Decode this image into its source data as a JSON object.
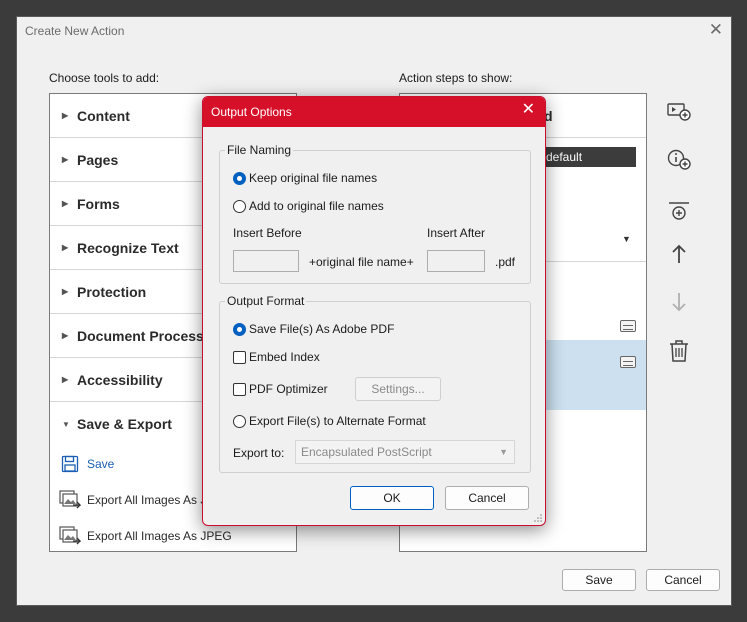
{
  "outer_dialog": {
    "title": "Create New Action",
    "tools_label": "Choose tools to add:",
    "steps_label": "Action steps to show:",
    "save_button": "Save",
    "cancel_button": "Cancel"
  },
  "tools": {
    "categories": [
      {
        "label": "Content",
        "expanded": false
      },
      {
        "label": "Pages",
        "expanded": false
      },
      {
        "label": "Forms",
        "expanded": false
      },
      {
        "label": "Recognize Text",
        "expanded": false
      },
      {
        "label": "Protection",
        "expanded": false
      },
      {
        "label": "Document Processi",
        "expanded": false
      },
      {
        "label": "Accessibility",
        "expanded": false
      },
      {
        "label": "Save & Export",
        "expanded": true
      }
    ],
    "sub_items": [
      {
        "label": "Save",
        "icon": "floppy-disk-icon"
      },
      {
        "label": "Export All Images As JI",
        "icon": "export-images-icon"
      },
      {
        "label": "Export All Images As JPEG",
        "icon": "export-images-icon"
      }
    ]
  },
  "steps": {
    "title_fragment": "d",
    "selected_fragment": "default"
  },
  "side_icons": [
    "insert-instruction-icon",
    "add-info-icon",
    "insert-separator-icon",
    "move-up-icon",
    "move-down-icon",
    "delete-icon"
  ],
  "modal": {
    "title": "Output Options",
    "file_naming": {
      "legend": "File Naming",
      "keep_original": "Keep original file names",
      "add_to_original": "Add to original file names",
      "insert_before_label": "Insert Before",
      "insert_after_label": "Insert After",
      "middle_text": "+original file name+",
      "extension": ".pdf"
    },
    "output_format": {
      "legend": "Output Format",
      "save_as_pdf": "Save File(s) As Adobe PDF",
      "embed_index": "Embed Index",
      "pdf_optimizer": "PDF Optimizer",
      "settings_button": "Settings...",
      "export_alternate": "Export File(s) to Alternate Format",
      "export_to_label": "Export to:",
      "export_to_value": "Encapsulated PostScript"
    },
    "ok_button": "OK",
    "cancel_button": "Cancel"
  },
  "colors": {
    "accent_red": "#d7102a",
    "radio_blue": "#0060c0",
    "selection_blue": "#cce0f0"
  }
}
